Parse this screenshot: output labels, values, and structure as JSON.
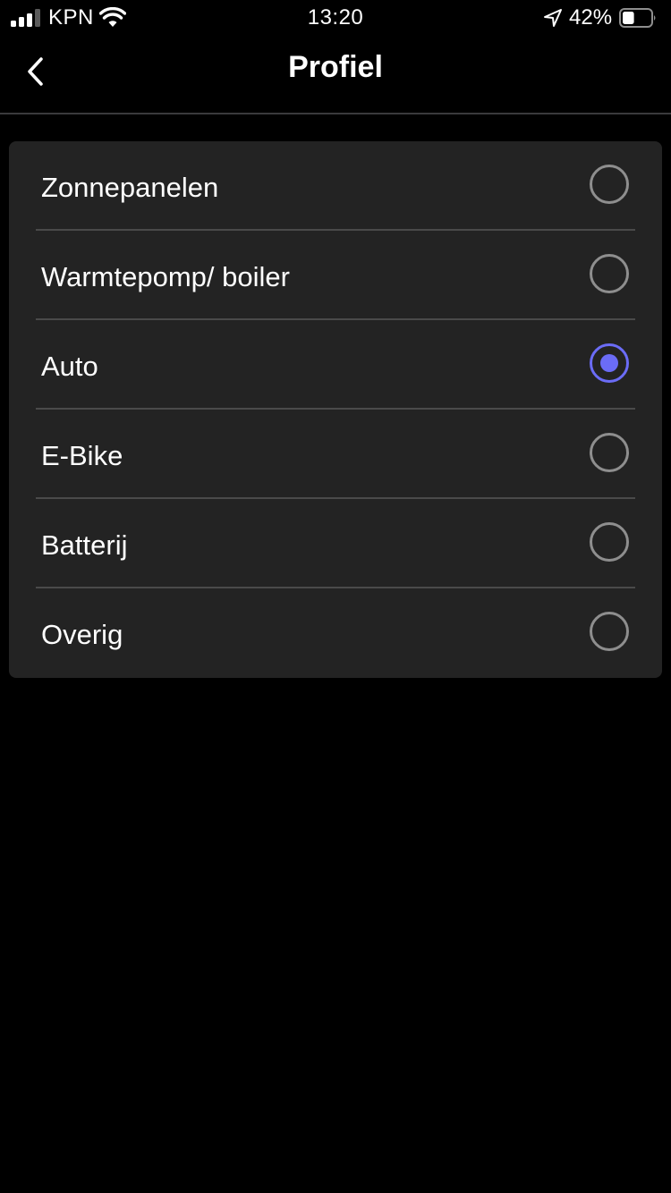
{
  "status_bar": {
    "carrier": "KPN",
    "time": "13:20",
    "battery_percent": "42%",
    "battery_level": 0.42,
    "signal_bars_filled": 3,
    "icons": [
      "signal-icon",
      "wifi-icon",
      "location-arrow-icon",
      "battery-icon"
    ]
  },
  "nav": {
    "title": "Profiel",
    "back_icon": "chevron-left-icon"
  },
  "options": [
    {
      "label": "Zonnepanelen",
      "selected": false
    },
    {
      "label": "Warmtepomp/ boiler",
      "selected": false
    },
    {
      "label": "Auto",
      "selected": true
    },
    {
      "label": "E-Bike",
      "selected": false
    },
    {
      "label": "Batterij",
      "selected": false
    },
    {
      "label": "Overig",
      "selected": false
    }
  ],
  "colors": {
    "background": "#000000",
    "card": "#232323",
    "accent": "#6b6cf6",
    "radio_border": "#8e8e8e",
    "divider": "#4a4a4a"
  }
}
